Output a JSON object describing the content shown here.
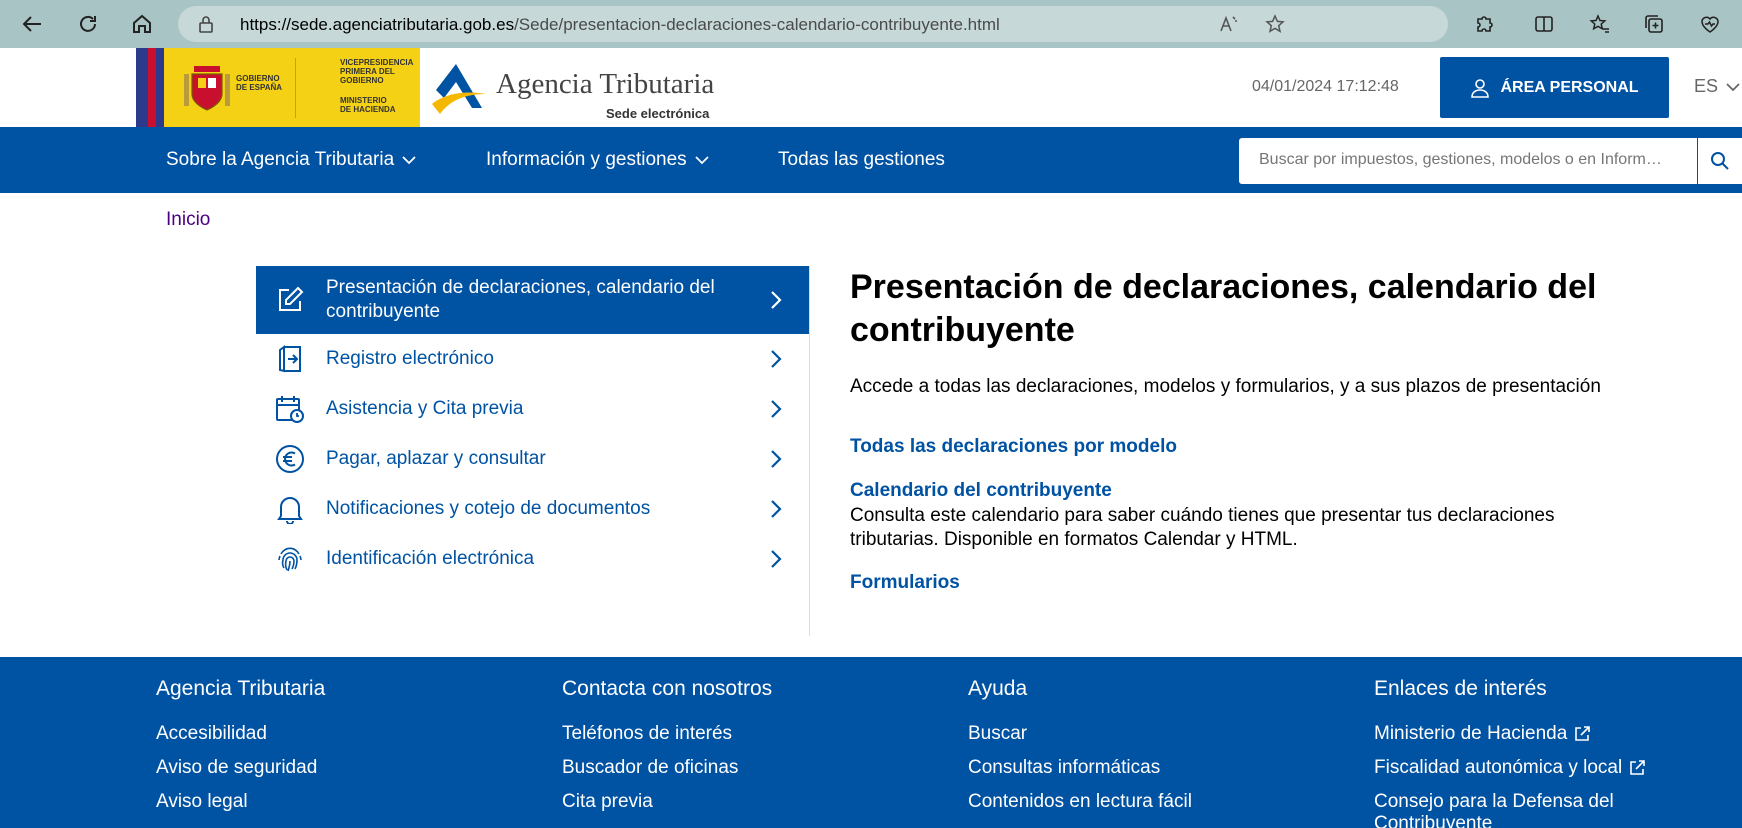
{
  "browser": {
    "url_host": "https://sede.agenciatributaria.gob.es",
    "url_path": "/Sede/presentacion-declaraciones-calendario-contribuyente.html"
  },
  "header": {
    "gov_text_1": "GOBIERNO\nDE ESPAÑA",
    "gov_text_2": "VICEPRESIDENCIA\nPRIMERA DEL GOBIERNO",
    "gov_text_3": "MINISTERIO\nDE HACIENDA",
    "brand_name": "Agencia Tributaria",
    "brand_sub": "Sede electrónica",
    "datetime": "04/01/2024 17:12:48",
    "area_personal": "ÁREA PERSONAL",
    "lang": "ES"
  },
  "nav": {
    "items": [
      {
        "label": "Sobre la Agencia Tributaria"
      },
      {
        "label": "Información y gestiones"
      },
      {
        "label": "Todas las gestiones"
      }
    ],
    "search_placeholder": "Buscar por impuestos, gestiones, modelos o en Información"
  },
  "breadcrumb": "Inicio",
  "menu": {
    "items": [
      {
        "label": "Presentación de declaraciones, calendario del contribuyente",
        "icon": "edit-icon"
      },
      {
        "label": "Registro electrónico",
        "icon": "door-in-icon"
      },
      {
        "label": "Asistencia y Cita previa",
        "icon": "calendar-clock-icon"
      },
      {
        "label": "Pagar, aplazar y consultar",
        "icon": "euro-icon"
      },
      {
        "label": "Notificaciones y cotejo de documentos",
        "icon": "bell-icon"
      },
      {
        "label": "Identificación electrónica",
        "icon": "fingerprint-icon"
      }
    ]
  },
  "main": {
    "title": "Presentación de declaraciones, calendario del contribuyente",
    "intro": "Accede a todas las declaraciones, modelos y formularios, y a sus plazos de presentación",
    "link1": "Todas las declaraciones por modelo",
    "link2": "Calendario del contribuyente",
    "link2_desc": "Consulta este calendario para saber cuándo tienes que presentar tus declaraciones tributarias. Disponible en formatos Calendar y HTML.",
    "link3": "Formularios"
  },
  "footer": {
    "col1": {
      "title": "Agencia Tributaria",
      "links": [
        "Accesibilidad",
        "Aviso de seguridad",
        "Aviso legal"
      ]
    },
    "col2": {
      "title": "Contacta con nosotros",
      "links": [
        "Teléfonos de interés",
        "Buscador de oficinas",
        "Cita previa"
      ]
    },
    "col3": {
      "title": "Ayuda",
      "links": [
        "Buscar",
        "Consultas informáticas",
        "Contenidos en lectura fácil"
      ]
    },
    "col4": {
      "title": "Enlaces de interés",
      "links": [
        "Ministerio de Hacienda",
        "Fiscalidad autonómica y local",
        "Consejo para la Defensa del Contribuyente"
      ]
    }
  },
  "colors": {
    "brand_blue": "#0052a3",
    "visited_link": "#4a0082"
  }
}
